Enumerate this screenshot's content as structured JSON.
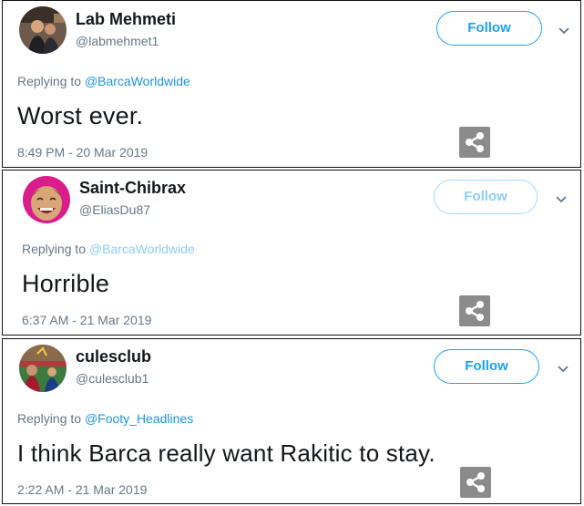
{
  "tweets": [
    {
      "name": "Lab Mehmeti",
      "handle": "@labmehmet1",
      "follow_label": "Follow",
      "replying_prefix": "Replying to",
      "replying_to": "@BarcaWorldwide",
      "text": "Worst ever.",
      "timestamp": "8:49 PM - 20 Mar 2019",
      "avatar_icon": "user-photo-icon",
      "share_icon": "share-icon"
    },
    {
      "name": "Saint-Chibrax",
      "handle": "@EliasDu87",
      "follow_label": "Follow",
      "replying_prefix": "Replying to",
      "replying_to": "@BarcaWorldwide",
      "text": "Horrible",
      "timestamp": "6:37 AM - 21 Mar 2019",
      "avatar_icon": "laughing-man-icon",
      "share_icon": "share-icon"
    },
    {
      "name": "culesclub",
      "handle": "@culesclub1",
      "follow_label": "Follow",
      "replying_prefix": "Replying to",
      "replying_to": "@Footy_Headlines",
      "text": "I think Barca really want Rakitic to stay.",
      "timestamp": "2:22 AM - 21 Mar 2019",
      "avatar_icon": "football-crowd-icon",
      "share_icon": "share-icon"
    }
  ],
  "colors": {
    "accent": "#1da1f2",
    "mention": "#1b95e0",
    "muted_text": "#657786",
    "share_button": "#8b8b8b"
  }
}
